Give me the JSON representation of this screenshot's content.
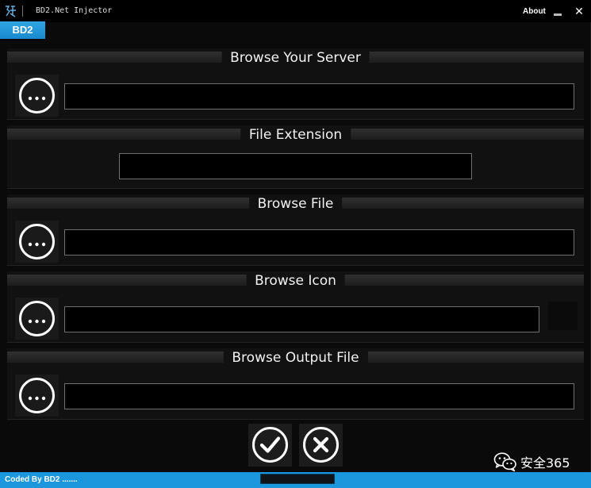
{
  "window": {
    "title": "BD2.Net Injector",
    "logo_icon": "logo-icon",
    "about_label": "About",
    "minimize_icon": "minimize-icon",
    "close_icon": "close-icon",
    "close_glyph": "✕"
  },
  "tabs": [
    {
      "label": "BD2",
      "active": true
    }
  ],
  "sections": {
    "server": {
      "title": "Browse Your Server",
      "value": "",
      "button_icon": "ellipsis-icon"
    },
    "extension": {
      "title": "File Extension",
      "value": ""
    },
    "file": {
      "title": "Browse File",
      "value": "",
      "button_icon": "ellipsis-icon"
    },
    "icon": {
      "title": "Browse Icon",
      "value": "",
      "button_icon": "ellipsis-icon"
    },
    "output": {
      "title": "Browse Output File",
      "value": "",
      "button_icon": "ellipsis-icon"
    }
  },
  "actions": {
    "confirm_icon": "check-icon",
    "cancel_icon": "x-circle-icon"
  },
  "watermark": {
    "icon": "wechat-icon",
    "text": "安全365"
  },
  "statusbar": {
    "text": "Coded By BD2 .......",
    "progress": 0
  },
  "colors": {
    "accent": "#1b97dd",
    "background": "#0a0a0a",
    "field_border": "#6f6f6f"
  }
}
